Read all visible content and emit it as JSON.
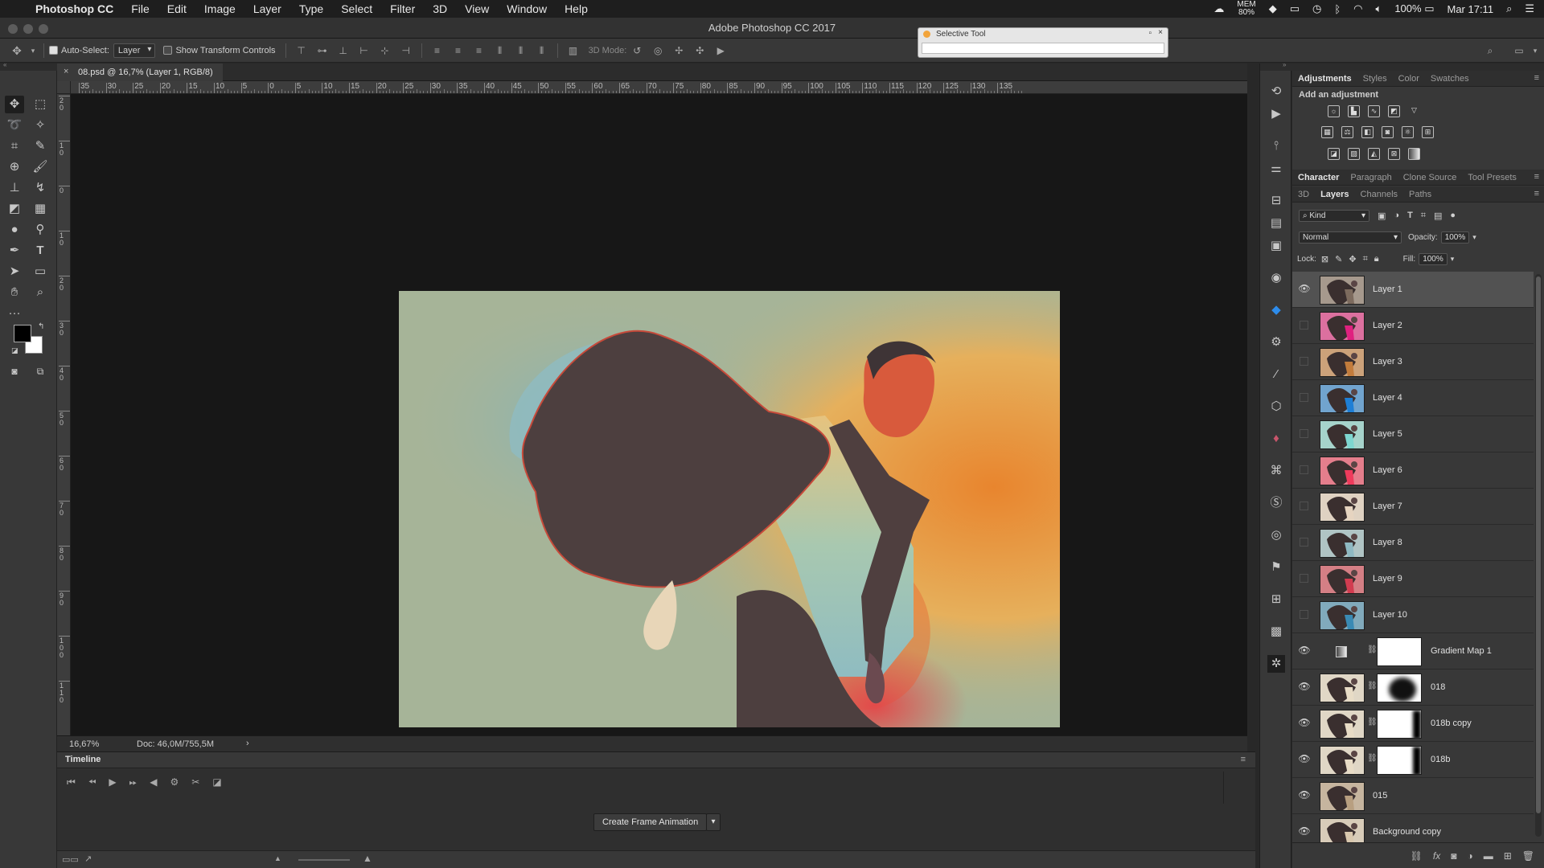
{
  "menubar": {
    "app_name": "Photoshop CC",
    "menus": [
      "File",
      "Edit",
      "Image",
      "Layer",
      "Type",
      "Select",
      "Filter",
      "3D",
      "View",
      "Window",
      "Help"
    ],
    "status": {
      "memory": "80%",
      "memory_label": "MEM",
      "battery": "100%",
      "clock": "Mar 17:11"
    }
  },
  "window": {
    "title": "Adobe Photoshop CC 2017"
  },
  "selective_tool": {
    "title": "Selective Tool"
  },
  "options_bar": {
    "auto_select_label": "Auto-Select:",
    "auto_select_checked": true,
    "auto_select_value": "Layer",
    "transform_label": "Show Transform Controls",
    "mode_label": "3D Mode:"
  },
  "document": {
    "tab_title": "08.psd @ 16,7% (Layer 1, RGB/8)",
    "ruler_h": [
      "35",
      "30",
      "25",
      "20",
      "15",
      "10",
      "5",
      "0",
      "5",
      "10",
      "15",
      "20",
      "25",
      "30",
      "35",
      "40",
      "45",
      "50",
      "55",
      "60",
      "65",
      "70",
      "75",
      "80",
      "85",
      "90",
      "95",
      "100",
      "105",
      "110",
      "115",
      "120",
      "125",
      "130",
      "135"
    ],
    "ruler_v": [
      "2\n0",
      "1\n0",
      "0",
      "1\n0",
      "2\n0",
      "3\n0",
      "4\n0",
      "5\n0",
      "6\n0",
      "7\n0",
      "8\n0",
      "9\n0",
      "1\n0\n0",
      "1\n1\n0"
    ],
    "zoom": "16,67%",
    "doc_size": "Doc: 46,0M/755,5M"
  },
  "timeline": {
    "title": "Timeline",
    "create_button": "Create Frame Animation"
  },
  "panels": {
    "top_tabs": [
      {
        "label": "Adjustments",
        "active": true
      },
      {
        "label": "Styles",
        "active": false
      },
      {
        "label": "Color",
        "active": false
      },
      {
        "label": "Swatches",
        "active": false
      }
    ],
    "adjustment_hint": "Add an adjustment",
    "mid_tabs": [
      {
        "label": "Character",
        "active": true
      },
      {
        "label": "Paragraph",
        "active": false
      },
      {
        "label": "Clone Source",
        "active": false
      },
      {
        "label": "Tool Presets",
        "active": false
      }
    ],
    "layer_tabs": [
      {
        "label": "3D",
        "active": false
      },
      {
        "label": "Layers",
        "active": true
      },
      {
        "label": "Channels",
        "active": false
      },
      {
        "label": "Paths",
        "active": false
      }
    ],
    "filter_kind": "Kind",
    "blend_mode": "Normal",
    "opacity_label": "Opacity:",
    "opacity": "100%",
    "lock_label": "Lock:",
    "fill_label": "Fill:",
    "fill": "100%"
  },
  "layers": [
    {
      "name": "Layer 1",
      "visible": true,
      "selected": true,
      "thumb": "#7d6b5e",
      "mask": false
    },
    {
      "name": "Layer 2",
      "visible": false,
      "selected": false,
      "thumb": "#e0217f",
      "mask": false
    },
    {
      "name": "Layer 3",
      "visible": false,
      "selected": false,
      "thumb": "#c37c3c",
      "mask": false
    },
    {
      "name": "Layer 4",
      "visible": false,
      "selected": false,
      "thumb": "#1e7fd6",
      "mask": false
    },
    {
      "name": "Layer 5",
      "visible": false,
      "selected": false,
      "thumb": "#7ed6d0",
      "mask": false
    },
    {
      "name": "Layer 6",
      "visible": false,
      "selected": false,
      "thumb": "#ef3b5c",
      "mask": false
    },
    {
      "name": "Layer 7",
      "visible": false,
      "selected": false,
      "thumb": "#e6d4c0",
      "mask": false
    },
    {
      "name": "Layer 8",
      "visible": false,
      "selected": false,
      "thumb": "#8fb9c2",
      "mask": false
    },
    {
      "name": "Layer 9",
      "visible": false,
      "selected": false,
      "thumb": "#d23c50",
      "mask": false
    },
    {
      "name": "Layer 10",
      "visible": false,
      "selected": false,
      "thumb": "#3a8ab4",
      "mask": false
    },
    {
      "name": "Gradient Map 1",
      "visible": true,
      "selected": false,
      "thumb": "adjustment",
      "mask": true
    },
    {
      "name": "018",
      "visible": true,
      "selected": false,
      "thumb": "#e8dcc6",
      "mask": true
    },
    {
      "name": "018b copy",
      "visible": true,
      "selected": false,
      "thumb": "#e8dcc6",
      "mask": true
    },
    {
      "name": "018b",
      "visible": true,
      "selected": false,
      "thumb": "#e8dcc6",
      "mask": true
    },
    {
      "name": "015",
      "visible": true,
      "selected": false,
      "thumb": "#b89f80",
      "mask": false
    },
    {
      "name": "Background copy",
      "visible": true,
      "selected": false,
      "thumb": "#d9c8ae",
      "mask": false
    }
  ],
  "colors": {
    "accent": "#2d8ceb",
    "canvas_bg": "#171717",
    "panel_bg": "#383838"
  }
}
